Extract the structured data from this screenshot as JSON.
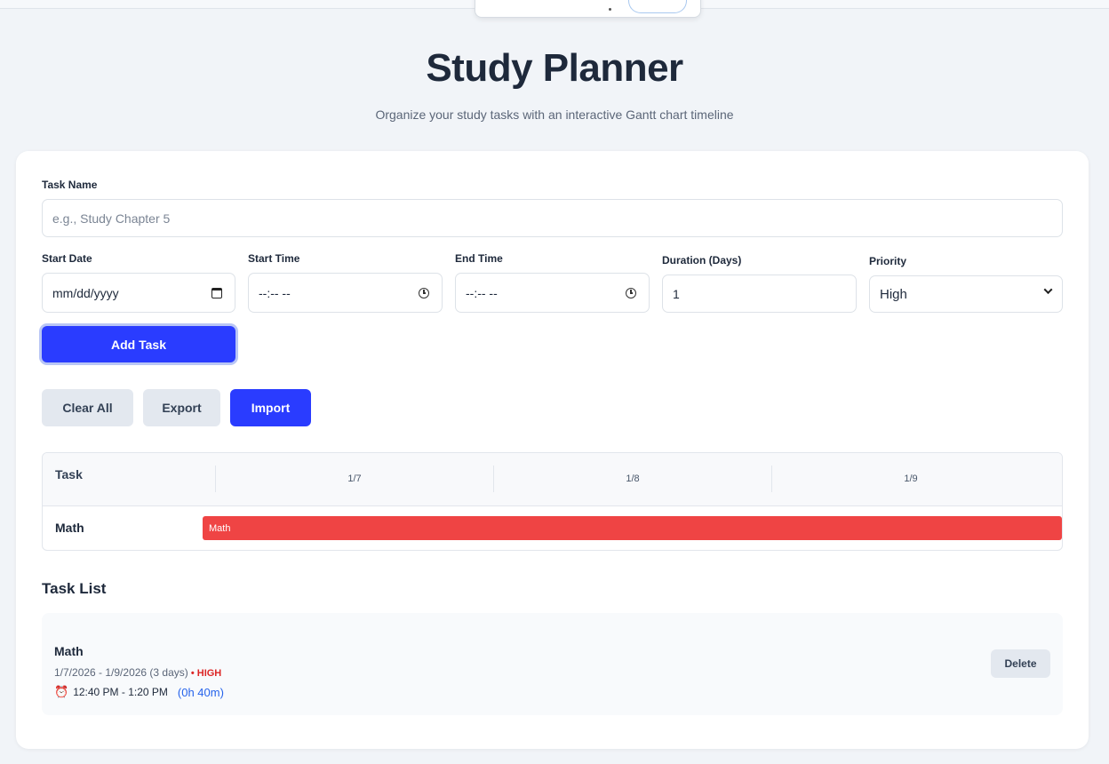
{
  "header": {
    "title": "Study Planner",
    "subtitle": "Organize your study tasks with an interactive Gantt chart timeline"
  },
  "form": {
    "task_name_label": "Task Name",
    "task_name_placeholder": "e.g., Study Chapter 5",
    "start_date_label": "Start Date",
    "start_date_value": "mm/dd/yyyy",
    "start_time_label": "Start Time",
    "start_time_value": "--:-- --",
    "end_time_label": "End Time",
    "end_time_value": "--:-- --",
    "duration_label": "Duration (Days)",
    "duration_value": "1",
    "priority_label": "Priority",
    "priority_value": "High",
    "add_button": "Add Task"
  },
  "actions": {
    "clear_all": "Clear All",
    "export": "Export",
    "import": "Import"
  },
  "gantt": {
    "task_header": "Task",
    "days": [
      "1/7",
      "1/8",
      "1/9"
    ],
    "rows": [
      {
        "name": "Math",
        "bar_label": "Math",
        "color": "#ef4444"
      }
    ]
  },
  "task_list": {
    "title": "Task List",
    "items": [
      {
        "name": "Math",
        "dates": "1/7/2026 - 1/9/2026 (3 days)",
        "separator": " • ",
        "priority": "HIGH",
        "time_icon": "alarm-clock-icon",
        "time": "12:40 PM - 1:20 PM",
        "duration": "(0h 40m)",
        "delete_label": "Delete"
      }
    ]
  },
  "colors": {
    "primary": "#2a3cff",
    "high_priority": "#dc2626",
    "bar": "#ef4444",
    "duration_text": "#2563eb"
  }
}
